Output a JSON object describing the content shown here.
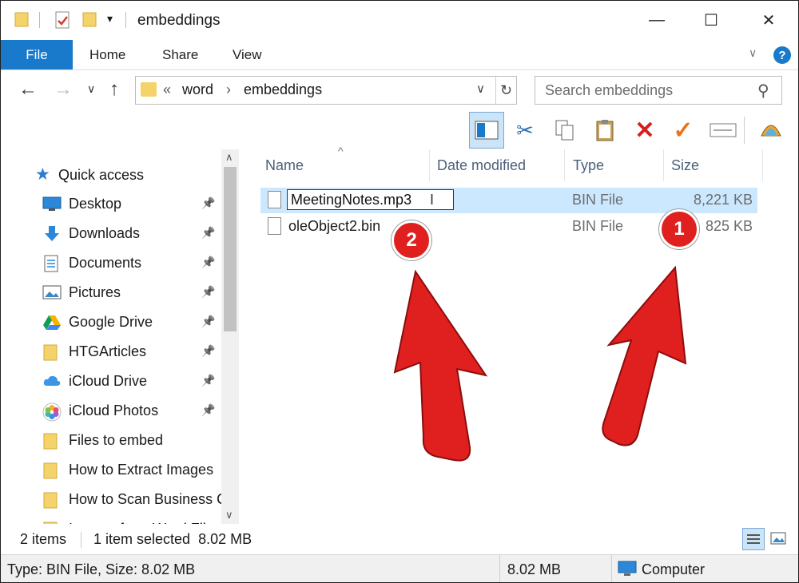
{
  "window": {
    "title": "embeddings",
    "minimize": "—",
    "maximize": "☐",
    "close": "✕"
  },
  "ribbon": {
    "tabs": [
      "File",
      "Home",
      "Share",
      "View"
    ],
    "help": "?"
  },
  "address": {
    "overflow": "«",
    "crumbs": [
      "word",
      "embeddings"
    ],
    "search_placeholder": "Search embeddings"
  },
  "nav": {
    "quick_access": "Quick access",
    "items": [
      {
        "label": "Desktop",
        "icon": "desktop-icon",
        "pinned": true
      },
      {
        "label": "Downloads",
        "icon": "downloads-icon",
        "pinned": true
      },
      {
        "label": "Documents",
        "icon": "documents-icon",
        "pinned": true
      },
      {
        "label": "Pictures",
        "icon": "pictures-icon",
        "pinned": true
      },
      {
        "label": "Google Drive",
        "icon": "google-drive-icon",
        "pinned": true
      },
      {
        "label": "HTGArticles",
        "icon": "folder-icon",
        "pinned": true
      },
      {
        "label": "iCloud Drive",
        "icon": "icloud-drive-icon",
        "pinned": true
      },
      {
        "label": "iCloud Photos",
        "icon": "icloud-photos-icon",
        "pinned": true
      },
      {
        "label": "Files to embed",
        "icon": "folder-icon",
        "pinned": false
      },
      {
        "label": "How to Extract Images",
        "icon": "folder-icon",
        "pinned": false
      },
      {
        "label": "How to Scan Business C",
        "icon": "folder-icon",
        "pinned": false
      },
      {
        "label": "Images from Word Files",
        "icon": "folder-icon",
        "pinned": false
      }
    ]
  },
  "columns": {
    "name": "Name",
    "date_modified": "Date modified",
    "type": "Type",
    "size": "Size"
  },
  "files": [
    {
      "name": "MeetingNotes.mp3",
      "type": "BIN File",
      "size": "8,221 KB",
      "selected": true,
      "renaming": true
    },
    {
      "name": "oleObject2.bin",
      "type": "BIN File",
      "size": "825 KB",
      "selected": false,
      "renaming": false
    }
  ],
  "status": {
    "item_count": "2 items",
    "selection": "1 item selected  8.02 MB"
  },
  "details_bar": {
    "info": "Type: BIN File, Size: 8.02 MB",
    "size": "8.02 MB",
    "location": "Computer"
  },
  "annotations": {
    "badge_1": "1",
    "badge_2": "2"
  },
  "colors": {
    "accent": "#1979ca",
    "selection": "#cce8ff",
    "annotation_red": "#e01f1f"
  }
}
